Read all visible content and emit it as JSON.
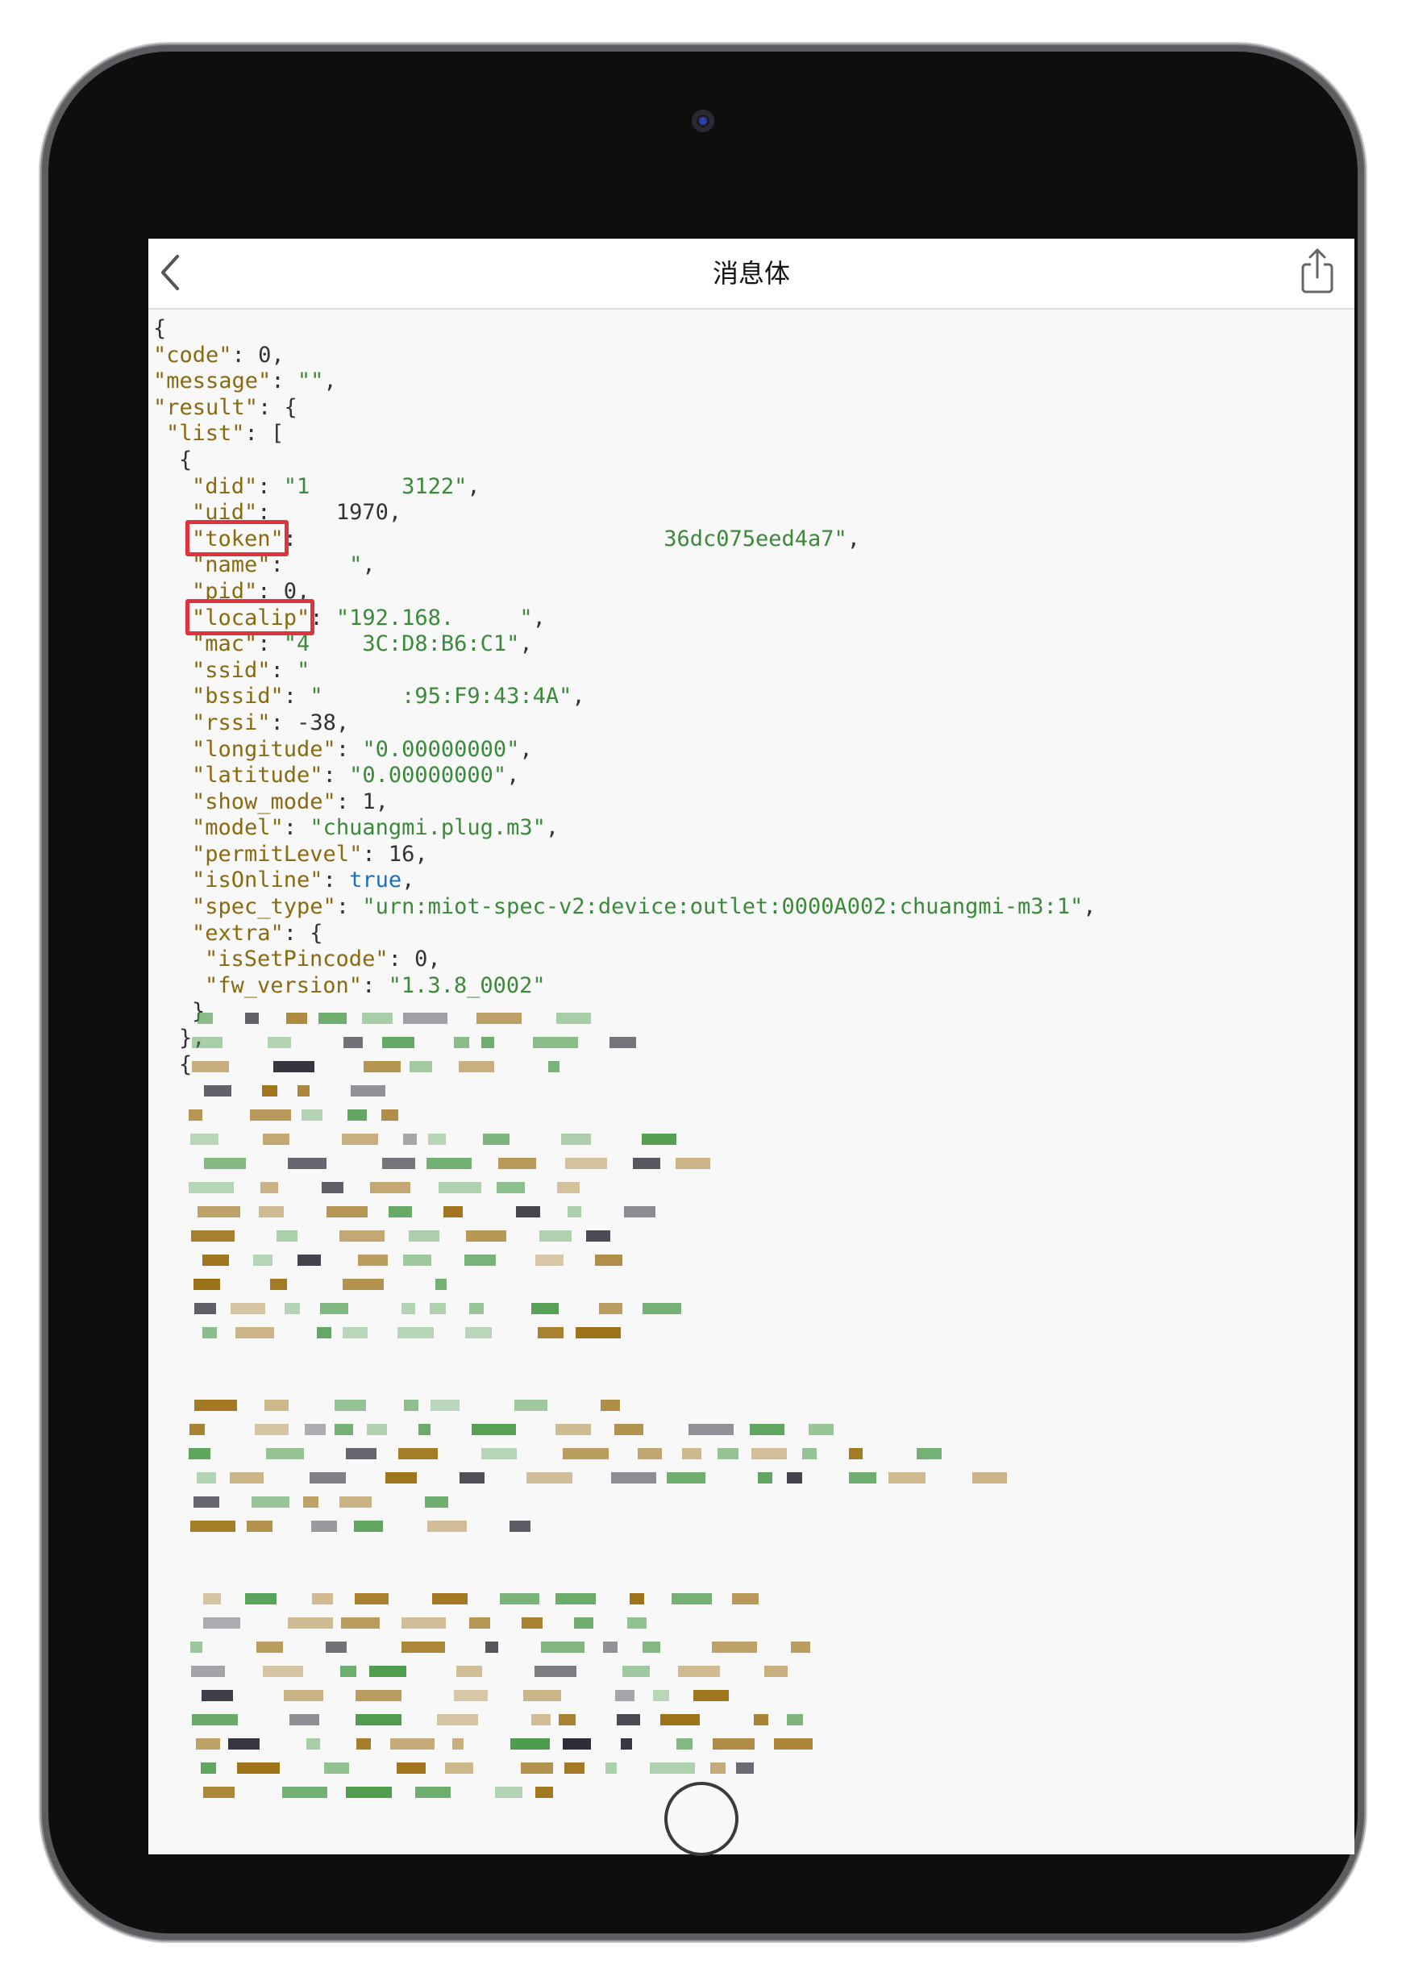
{
  "nav": {
    "title": "消息体",
    "back_icon": "chevron-left-icon",
    "share_icon": "share-icon"
  },
  "json_lines": [
    {
      "i": 0,
      "parts": [
        [
          "p",
          "{"
        ]
      ]
    },
    {
      "i": 0,
      "parts": [
        [
          "k",
          "\"code\""
        ],
        [
          "p",
          ": "
        ],
        [
          "n",
          "0"
        ],
        [
          "p",
          ","
        ]
      ]
    },
    {
      "i": 0,
      "parts": [
        [
          "k",
          "\"message\""
        ],
        [
          "p",
          ": "
        ],
        [
          "s",
          "\"\""
        ],
        [
          "p",
          ","
        ]
      ]
    },
    {
      "i": 0,
      "parts": [
        [
          "k",
          "\"result\""
        ],
        [
          "p",
          ": {"
        ]
      ]
    },
    {
      "i": 1,
      "parts": [
        [
          "k",
          "\"list\""
        ],
        [
          "p",
          ": ["
        ]
      ]
    },
    {
      "i": 2,
      "parts": [
        [
          "p",
          "{"
        ]
      ]
    },
    {
      "i": 3,
      "parts": [
        [
          "k",
          "\"did\""
        ],
        [
          "p",
          ": "
        ],
        [
          "s",
          "\"1       3122\""
        ],
        [
          "p",
          ","
        ]
      ]
    },
    {
      "i": 3,
      "parts": [
        [
          "k",
          "\"uid\""
        ],
        [
          "p",
          ":     "
        ],
        [
          "n",
          "1970"
        ],
        [
          "p",
          ","
        ]
      ]
    },
    {
      "i": 3,
      "parts": [
        [
          "k",
          "\"token\""
        ],
        [
          "p",
          ":                            "
        ],
        [
          "s",
          "36dc075eed4a7\""
        ],
        [
          "p",
          ","
        ]
      ]
    },
    {
      "i": 3,
      "parts": [
        [
          "k",
          "\"name\""
        ],
        [
          "p",
          ": "
        ],
        [
          "s",
          "    \""
        ],
        [
          "p",
          ","
        ]
      ]
    },
    {
      "i": 3,
      "parts": [
        [
          "k",
          "\"pid\""
        ],
        [
          "p",
          ": "
        ],
        [
          "n",
          "0"
        ],
        [
          "p",
          ","
        ]
      ]
    },
    {
      "i": 3,
      "parts": [
        [
          "k",
          "\"localip\""
        ],
        [
          "p",
          ": "
        ],
        [
          "s",
          "\"192.168.     \""
        ],
        [
          "p",
          ","
        ]
      ]
    },
    {
      "i": 3,
      "parts": [
        [
          "k",
          "\"mac\""
        ],
        [
          "p",
          ": "
        ],
        [
          "s",
          "\"4    3C:D8:B6:C1\""
        ],
        [
          "p",
          ","
        ]
      ]
    },
    {
      "i": 3,
      "parts": [
        [
          "k",
          "\"ssid\""
        ],
        [
          "p",
          ": "
        ],
        [
          "s",
          "\""
        ]
      ]
    },
    {
      "i": 3,
      "parts": [
        [
          "k",
          "\"bssid\""
        ],
        [
          "p",
          ": "
        ],
        [
          "s",
          "\"      :95:F9:43:4A\""
        ],
        [
          "p",
          ","
        ]
      ]
    },
    {
      "i": 3,
      "parts": [
        [
          "k",
          "\"rssi\""
        ],
        [
          "p",
          ": "
        ],
        [
          "n",
          "-38"
        ],
        [
          "p",
          ","
        ]
      ]
    },
    {
      "i": 3,
      "parts": [
        [
          "k",
          "\"longitude\""
        ],
        [
          "p",
          ": "
        ],
        [
          "s",
          "\"0.00000000\""
        ],
        [
          "p",
          ","
        ]
      ]
    },
    {
      "i": 3,
      "parts": [
        [
          "k",
          "\"latitude\""
        ],
        [
          "p",
          ": "
        ],
        [
          "s",
          "\"0.00000000\""
        ],
        [
          "p",
          ","
        ]
      ]
    },
    {
      "i": 3,
      "parts": [
        [
          "k",
          "\"show_mode\""
        ],
        [
          "p",
          ": "
        ],
        [
          "n",
          "1"
        ],
        [
          "p",
          ","
        ]
      ]
    },
    {
      "i": 3,
      "parts": [
        [
          "k",
          "\"model\""
        ],
        [
          "p",
          ": "
        ],
        [
          "s",
          "\"chuangmi.plug.m3\""
        ],
        [
          "p",
          ","
        ]
      ]
    },
    {
      "i": 3,
      "parts": [
        [
          "k",
          "\"permitLevel\""
        ],
        [
          "p",
          ": "
        ],
        [
          "n",
          "16"
        ],
        [
          "p",
          ","
        ]
      ]
    },
    {
      "i": 3,
      "parts": [
        [
          "k",
          "\"isOnline\""
        ],
        [
          "p",
          ": "
        ],
        [
          "b",
          "true"
        ],
        [
          "p",
          ","
        ]
      ]
    },
    {
      "i": 3,
      "parts": [
        [
          "k",
          "\"spec_type\""
        ],
        [
          "p",
          ": "
        ],
        [
          "s",
          "\"urn:miot-spec-v2:device:outlet:0000A002:chuangmi-m3:1\""
        ],
        [
          "p",
          ","
        ]
      ]
    },
    {
      "i": 3,
      "parts": [
        [
          "k",
          "\"extra\""
        ],
        [
          "p",
          ": {"
        ]
      ]
    },
    {
      "i": 4,
      "parts": [
        [
          "k",
          "\"isSetPincode\""
        ],
        [
          "p",
          ": "
        ],
        [
          "n",
          "0"
        ],
        [
          "p",
          ","
        ]
      ]
    },
    {
      "i": 4,
      "parts": [
        [
          "k",
          "\"fw_version\""
        ],
        [
          "p",
          ": "
        ],
        [
          "s",
          "\"1.3.8_0002\""
        ]
      ]
    },
    {
      "i": 3,
      "parts": [
        [
          "p",
          "}"
        ]
      ]
    },
    {
      "i": 2,
      "parts": [
        [
          "p",
          "},"
        ]
      ]
    },
    {
      "i": 2,
      "parts": [
        [
          "p",
          "{"
        ]
      ]
    }
  ],
  "highlight_keys": [
    "\"token\"",
    "\"localip\""
  ],
  "colors": {
    "key": "#8a6a10",
    "string": "#3a8a3a",
    "number": "#333333",
    "boolean": "#1e6fb8",
    "highlight_box": "#e0343d",
    "redaction_brown": "#9a6c0e",
    "redaction_green": "#4a9a4a",
    "redaction_dark": "#2a2a35"
  }
}
